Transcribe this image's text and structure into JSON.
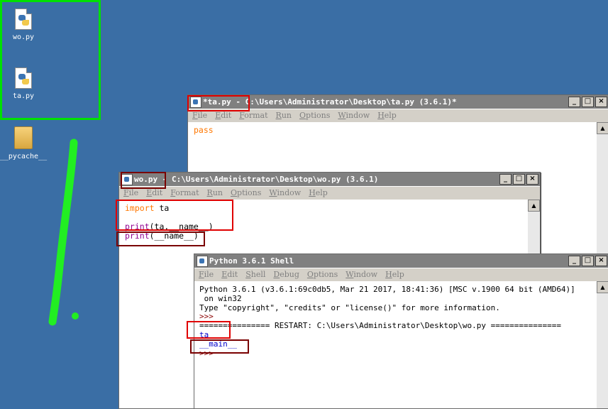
{
  "desktop": {
    "icons": [
      {
        "label": "wo.py",
        "icon": "python-file-icon"
      },
      {
        "label": "ta.py",
        "icon": "python-file-icon"
      },
      {
        "label": "__pycache__",
        "icon": "folder-icon"
      }
    ]
  },
  "windows": {
    "ta": {
      "title": "*ta.py - C:\\Users\\Administrator\\Desktop\\ta.py (3.6.1)*",
      "menu": [
        "File",
        "Edit",
        "Format",
        "Run",
        "Options",
        "Window",
        "Help"
      ],
      "code": [
        "pass"
      ]
    },
    "wo": {
      "title": "wo.py - C:\\Users\\Administrator\\Desktop\\wo.py (3.6.1)",
      "menu": [
        "File",
        "Edit",
        "Format",
        "Run",
        "Options",
        "Window",
        "Help"
      ],
      "code_line1_kw": "import",
      "code_line1_rest": " ta",
      "code_line2_fn": "print",
      "code_line2_rest": "(ta.__name__)",
      "code_line3_fn": "print",
      "code_line3_rest": "(__name__)"
    },
    "shell": {
      "title": "Python 3.6.1 Shell",
      "menu": [
        "File",
        "Edit",
        "Shell",
        "Debug",
        "Options",
        "Window",
        "Help"
      ],
      "lines": [
        "Python 3.6.1 (v3.6.1:69c0db5, Mar 21 2017, 18:41:36) [MSC v.1900 64 bit (AMD64)]",
        " on win32",
        "Type \"copyright\", \"credits\" or \"license()\" for more information.",
        ">>> ",
        "=============== RESTART: C:\\Users\\Administrator\\Desktop\\wo.py ===============",
        "ta",
        "__main__",
        ">>> "
      ]
    }
  },
  "window_buttons": {
    "minimize": "_",
    "maximize": "□",
    "close": "×"
  },
  "colors": {
    "desktop": "#3a6ea5",
    "highlight_green": "#00e000",
    "annotation_red": "#e00000",
    "annotation_darkred": "#7a0000",
    "keyword": "#ff7700",
    "builtin": "#900090",
    "output_blue": "#0000cc"
  }
}
